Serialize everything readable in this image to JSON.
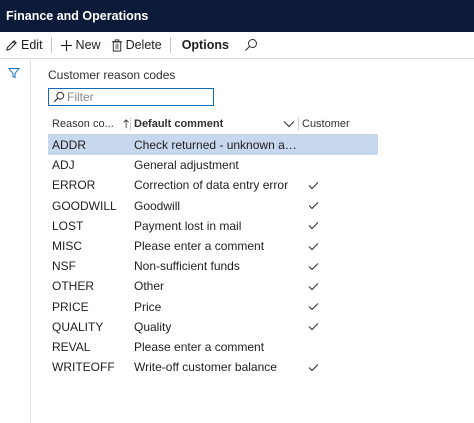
{
  "app": {
    "title": "Finance and Operations"
  },
  "actions": {
    "edit": "Edit",
    "new": "New",
    "delete": "Delete",
    "options": "Options"
  },
  "form": {
    "title": "Customer reason codes",
    "filter_placeholder": "Filter"
  },
  "grid": {
    "headers": {
      "reason_code": "Reason co...",
      "default_comment": "Default comment",
      "customer": "Customer"
    },
    "rows": [
      {
        "code": "ADDR",
        "comment": "Check returned - unknown address",
        "customer": false,
        "selected": true
      },
      {
        "code": "ADJ",
        "comment": "General adjustment",
        "customer": false,
        "selected": false
      },
      {
        "code": "ERROR",
        "comment": "Correction of data entry error",
        "customer": true,
        "selected": false
      },
      {
        "code": "GOODWILL",
        "comment": "Goodwill",
        "customer": true,
        "selected": false
      },
      {
        "code": "LOST",
        "comment": "Payment lost in mail",
        "customer": true,
        "selected": false
      },
      {
        "code": "MISC",
        "comment": "Please enter a comment",
        "customer": true,
        "selected": false
      },
      {
        "code": "NSF",
        "comment": "Non-sufficient funds",
        "customer": true,
        "selected": false
      },
      {
        "code": "OTHER",
        "comment": "Other",
        "customer": true,
        "selected": false
      },
      {
        "code": "PRICE",
        "comment": "Price",
        "customer": true,
        "selected": false
      },
      {
        "code": "QUALITY",
        "comment": "Quality",
        "customer": true,
        "selected": false
      },
      {
        "code": "REVAL",
        "comment": "Please enter a comment",
        "customer": false,
        "selected": false
      },
      {
        "code": "WRITEOFF",
        "comment": "Write-off customer balance",
        "customer": true,
        "selected": false
      }
    ]
  },
  "colors": {
    "header_bg": "#0c1a3a",
    "selected_row": "#c7d7ee",
    "accent": "#0f6cbd"
  }
}
